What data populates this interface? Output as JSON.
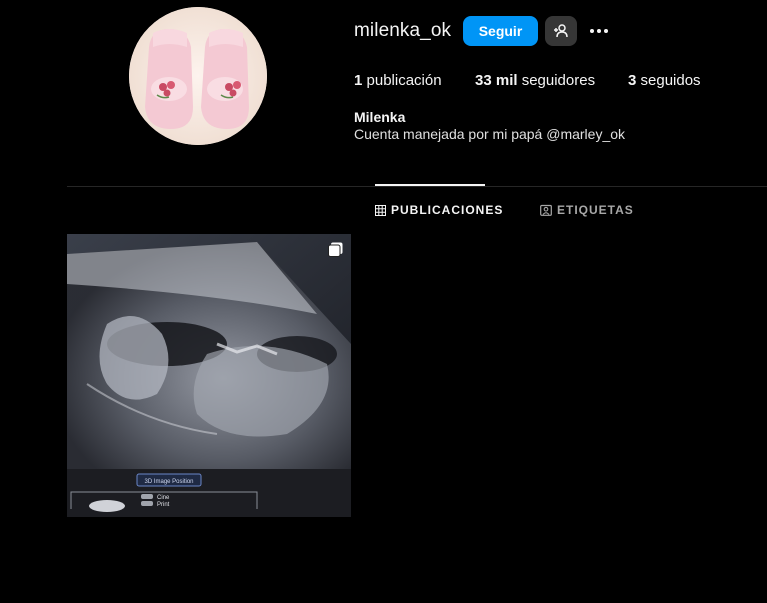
{
  "profile": {
    "username": "milenka_ok",
    "follow_label": "Seguir",
    "full_name": "Milenka",
    "bio": "Cuenta manejada por mi papá @marley_ok",
    "avatar_icon": "baby-booties-avatar"
  },
  "stats": {
    "posts_count": "1",
    "posts_label": " publicación",
    "followers_count": "33 mil",
    "followers_label": " seguidores",
    "following_count": "3",
    "following_label": " seguidos"
  },
  "tabs": [
    {
      "label": "PUBLICACIONES",
      "icon": "grid-icon",
      "active": true
    },
    {
      "label": "ETIQUETAS",
      "icon": "tagged-icon",
      "active": false
    }
  ],
  "post": {
    "overlay_label": "3D Image Position",
    "menu_items": [
      "Cine",
      "Print"
    ],
    "icon": "multiple-posts-icon"
  },
  "colors": {
    "background": "#000000",
    "follow_button": "#0095f6",
    "secondary_button": "#363636",
    "divider": "#262626",
    "muted_text": "#a8a8a8"
  }
}
